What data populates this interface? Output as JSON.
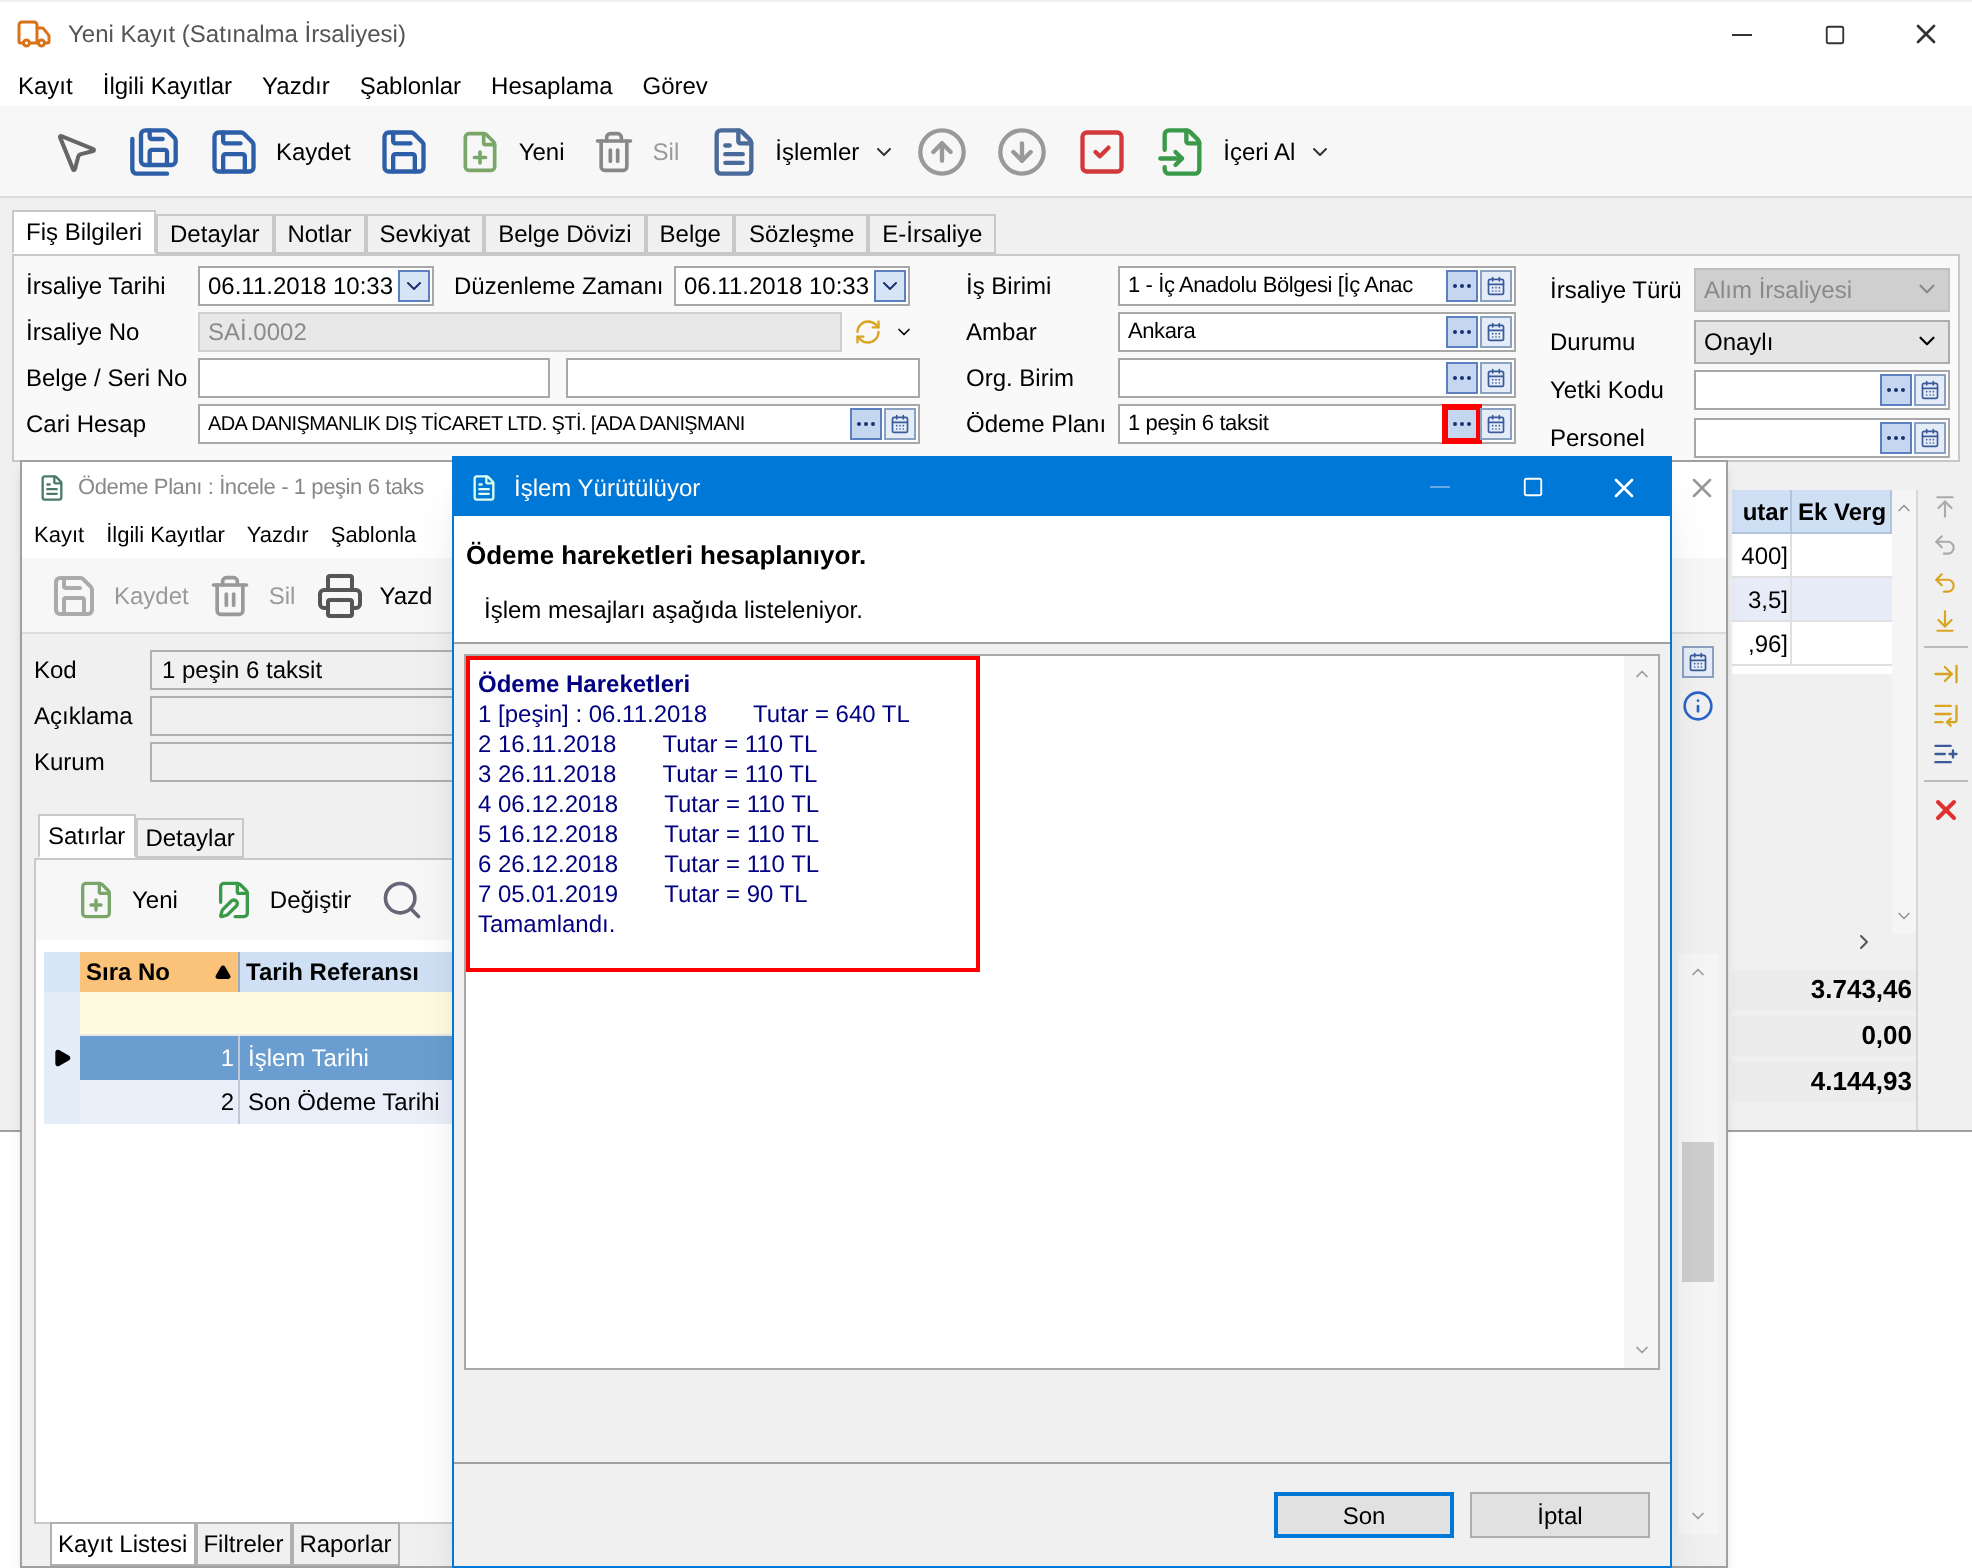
{
  "main_window": {
    "title": "Yeni Kayıt (Satınalma İrsaliyesi)",
    "menu": [
      "Kayıt",
      "İlgili Kayıtlar",
      "Yazdır",
      "Şablonlar",
      "Hesaplama",
      "Görev"
    ],
    "toolbar": {
      "save": "Kaydet",
      "new": "Yeni",
      "delete": {
        "label": "Sil",
        "disabled": true
      },
      "operations": "İşlemler",
      "import": "İçeri Al"
    },
    "tabs": [
      {
        "label": "Fiş Bilgileri",
        "selected": true
      },
      {
        "label": "Detaylar",
        "selected": false
      },
      {
        "label": "Notlar",
        "selected": false
      },
      {
        "label": "Sevkiyat",
        "selected": false
      },
      {
        "label": "Belge Dövizi",
        "selected": false
      },
      {
        "label": "Belge",
        "selected": false
      },
      {
        "label": "Sözleşme",
        "selected": false
      },
      {
        "label": "E-İrsaliye",
        "selected": false
      }
    ],
    "form": {
      "irsaliye_tarihi": {
        "label": "İrsaliye Tarihi",
        "value": "06.11.2018 10:33"
      },
      "duzenleme_zamani": {
        "label": "Düzenleme Zamanı",
        "value": "06.11.2018 10:33"
      },
      "irsaliye_no": {
        "label": "İrsaliye No",
        "value": "SAİ.0002",
        "disabled": true
      },
      "belge_seri_no": {
        "label": "Belge / Seri No"
      },
      "cari_hesap": {
        "label": "Cari Hesap",
        "value": "ADA DANIŞMANLIK DIŞ TİCARET LTD. ŞTİ. [ADA DANIŞMANI"
      },
      "lookups": [
        {
          "label": "İş Birimi",
          "value": "1 - İç Anadolu Bölgesi [İç Anac",
          "highlighted": false
        },
        {
          "label": "Ambar",
          "value": "Ankara",
          "highlighted": false
        },
        {
          "label": "Org. Birim",
          "highlighted": false
        },
        {
          "label": "Ödeme Planı",
          "value": "1 peşin 6 taksit",
          "highlighted": true
        }
      ],
      "irsaliye_turu": {
        "label": "İrsaliye Türü",
        "value": "Alım İrsaliyesi",
        "disabled": true
      },
      "durumu": {
        "label": "Durumu",
        "value": "Onaylı",
        "disabled": false
      },
      "right_lookups": [
        {
          "label": "Yetki Kodu"
        },
        {
          "label": "Personel"
        }
      ]
    },
    "grid": {
      "columns": [
        "utar",
        "Ek Verg"
      ],
      "rows": [
        "400]",
        "3,5]",
        ",96]"
      ],
      "totals": [
        "3.743,46",
        "0,00",
        "4.144,93"
      ]
    }
  },
  "payment_plan_window": {
    "title": "Ödeme Planı : İncele - 1 peşin 6 taks",
    "menu": [
      "Kayıt",
      "İlgili Kayıtlar",
      "Yazdır",
      "Şablonla"
    ],
    "toolbar": [
      {
        "label": "Kaydet",
        "disabled": true
      },
      {
        "label": "Sil",
        "disabled": true
      },
      {
        "label": "Yazd",
        "disabled": false
      }
    ],
    "form": [
      {
        "label": "Kod",
        "value": "1 peşin 6 taksit"
      },
      {
        "label": "Açıklama"
      },
      {
        "label": "Kurum"
      }
    ],
    "tabs": [
      {
        "label": "Satırlar",
        "selected": true
      },
      {
        "label": "Detaylar",
        "selected": false
      }
    ],
    "sub_toolbar": {
      "new": "Yeni",
      "edit": "Değiştir"
    },
    "grid": {
      "columns": [
        {
          "label": "Sıra No",
          "sorted": true
        },
        {
          "label": "Tarih Referansı",
          "sorted": false
        }
      ],
      "rows": [
        {
          "sira": "1",
          "tarih": "İşlem Tarihi",
          "selected": true
        },
        {
          "sira": "2",
          "tarih": "Son Ödeme Tarihi",
          "selected": false
        }
      ]
    },
    "bottom_tabs": [
      {
        "label": "Kayıt Listesi",
        "selected": true
      },
      {
        "label": "Filtreler",
        "selected": false
      },
      {
        "label": "Raporlar",
        "selected": false
      }
    ]
  },
  "dialog": {
    "title": "İşlem Yürütülüyor",
    "heading": "Ödeme hareketleri hesaplanıyor.",
    "subheading": "İşlem mesajları aşağıda listeleniyor.",
    "messages": {
      "title": "Ödeme Hareketleri",
      "highlighted": true,
      "lines": [
        {
          "date": "1 [peşin] : 06.11.2018",
          "amount": "Tutar = 640 TL"
        },
        {
          "date": "2 16.11.2018",
          "amount": "Tutar = 110 TL"
        },
        {
          "date": "3 26.11.2018",
          "amount": "Tutar = 110 TL"
        },
        {
          "date": "4 06.12.2018",
          "amount": "Tutar = 110 TL"
        },
        {
          "date": "5 16.12.2018",
          "amount": "Tutar = 110 TL"
        },
        {
          "date": "6 26.12.2018",
          "amount": "Tutar = 110 TL"
        },
        {
          "date": "7 05.01.2019",
          "amount": "Tutar = 90 TL"
        }
      ],
      "footer": "Tamamlandı."
    },
    "buttons": [
      {
        "label": "Son",
        "focused": true
      },
      {
        "label": "İptal",
        "focused": false
      }
    ]
  }
}
